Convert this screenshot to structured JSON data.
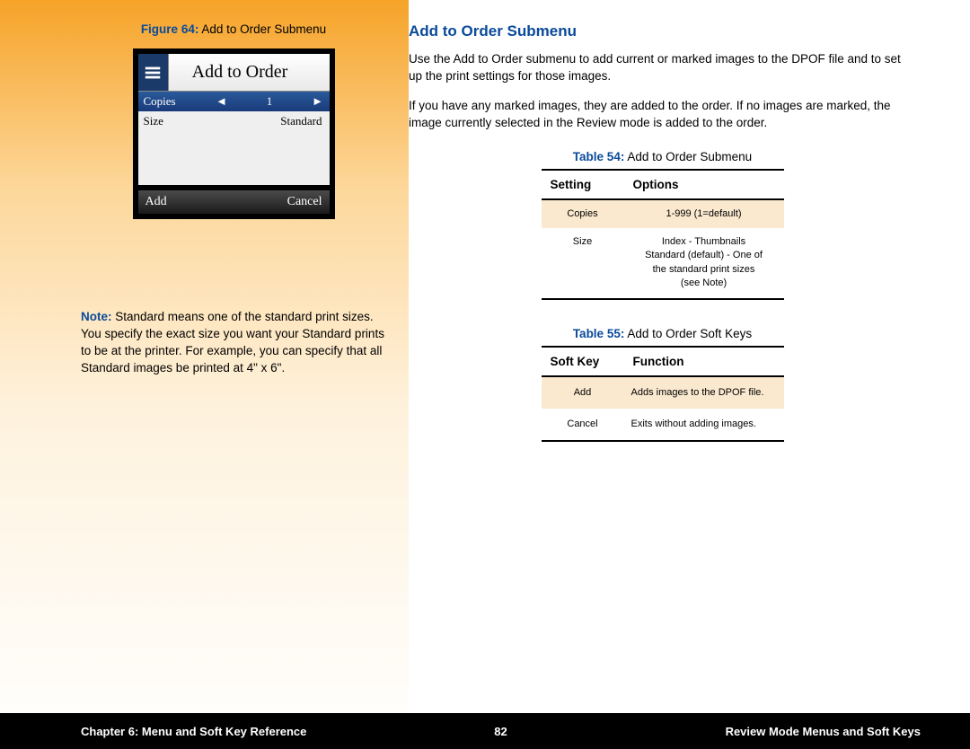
{
  "left": {
    "figure_label": "Figure 64:",
    "figure_title": "Add to Order Submenu",
    "lcd": {
      "title": "Add to Order",
      "row1_label": "Copies",
      "row1_value": "1",
      "row2_label": "Size",
      "row2_value": "Standard",
      "btn_left": "Add",
      "btn_right": "Cancel"
    },
    "note_label": "Note:",
    "note_text": "Standard means one of the standard print sizes. You specify the exact size you want your Standard prints to be at the printer. For example, you can specify that all Standard images be printed at 4\" x 6\"."
  },
  "right": {
    "heading": "Add to Order Submenu",
    "para1": "Use the Add to Order submenu to add current or marked images to the DPOF file and to set up the print settings for those images.",
    "para2": "If you have any marked images, they are added to the order. If no images are marked, the image currently selected in the Review mode is added to the order.",
    "table54": {
      "label": "Table 54:",
      "title": "Add to Order Submenu",
      "h1": "Setting",
      "h2": "Options",
      "rows": [
        {
          "c1": "Copies",
          "c2": "1-999 (1=default)"
        },
        {
          "c1": "Size",
          "c2": "Index - Thumbnails\nStandard (default) - One of\nthe standard print sizes\n(see Note)"
        }
      ]
    },
    "table55": {
      "label": "Table 55:",
      "title": "Add to Order Soft Keys",
      "h1": "Soft Key",
      "h2": "Function",
      "rows": [
        {
          "c1": "Add",
          "c2": "Adds images to the DPOF file."
        },
        {
          "c1": "Cancel",
          "c2": "Exits without adding images."
        }
      ]
    }
  },
  "footer": {
    "left": "Chapter 6: Menu and Soft Key Reference",
    "center": "82",
    "right": "Review Mode Menus and Soft Keys"
  }
}
